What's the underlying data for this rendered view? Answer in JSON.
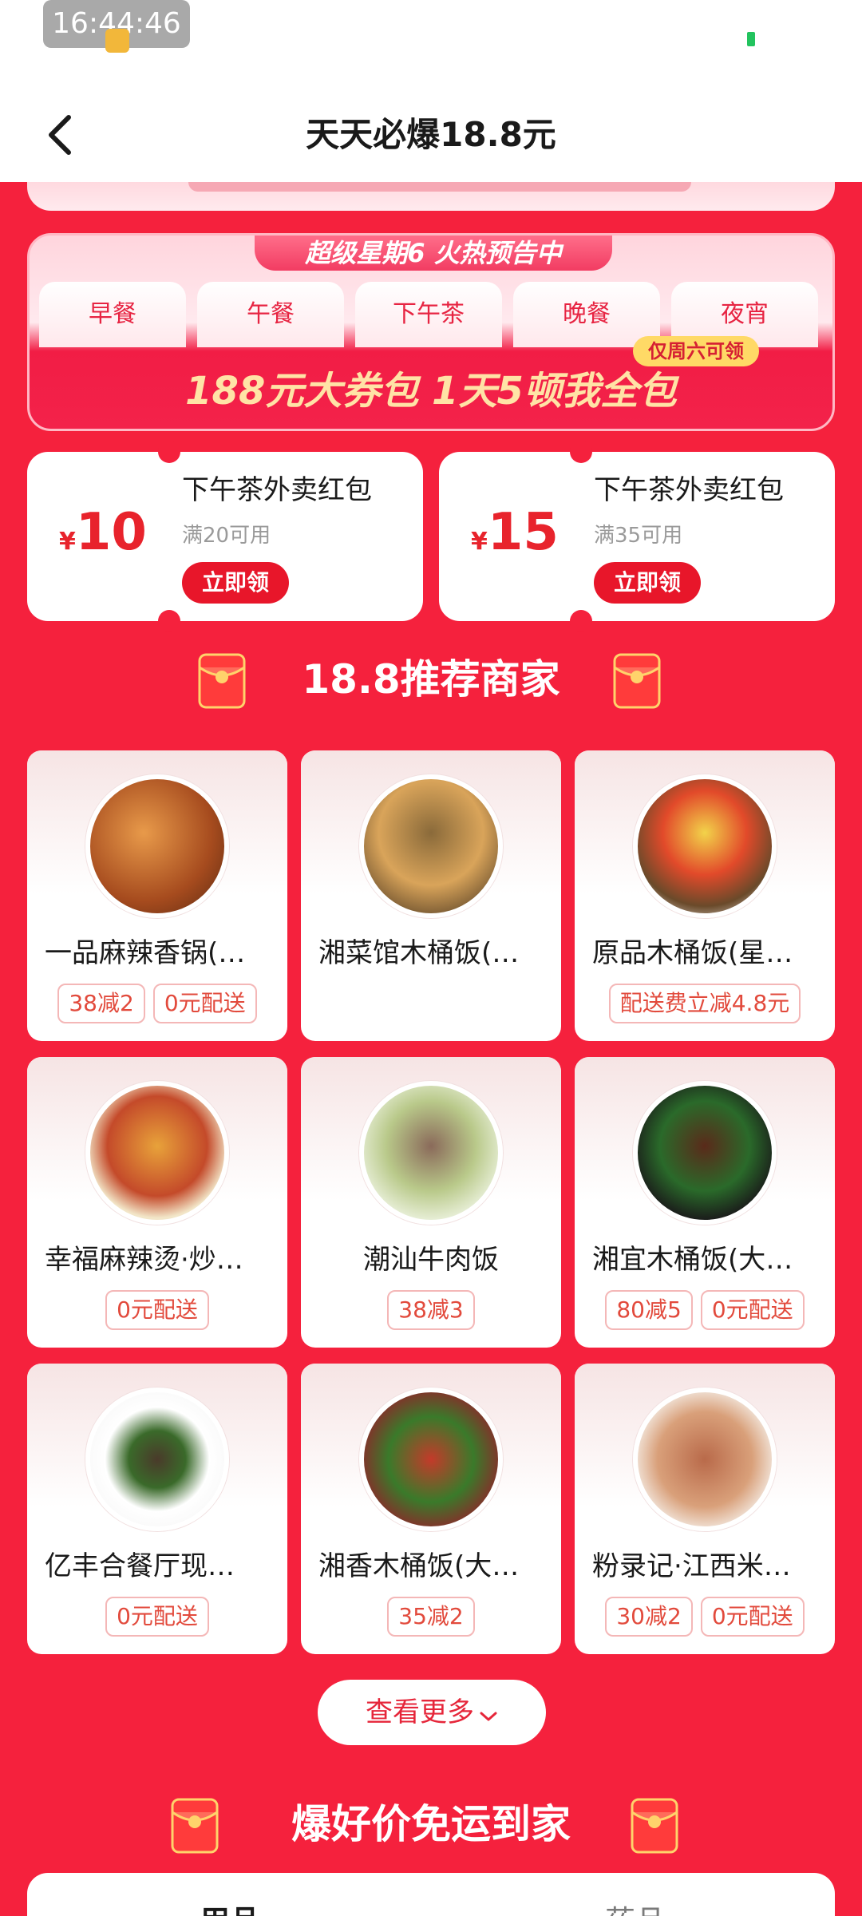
{
  "status_bar": {
    "time": "16:44:46"
  },
  "header": {
    "title": "天天必爆18.8元"
  },
  "promo_banner": {
    "tag": "超级星期6 火热预告中",
    "meals": [
      "早餐",
      "午餐",
      "下午茶",
      "晚餐",
      "夜宵"
    ],
    "weekday_badge": "仅周六可领",
    "slogan": "188元大券包 1天5顿我全包"
  },
  "coupons": [
    {
      "currency": "¥",
      "value": "10",
      "title": "下午茶外卖红包",
      "condition": "满20可用",
      "button": "立即领"
    },
    {
      "currency": "¥",
      "value": "15",
      "title": "下午茶外卖红包",
      "condition": "满35可用",
      "button": "立即领"
    }
  ],
  "merchants_section": {
    "title": "18.8推荐商家"
  },
  "merchants": [
    {
      "name": "一品麻辣香锅(…",
      "tags": [
        "38减2",
        "0元配送"
      ]
    },
    {
      "name": "湘菜馆木桶饭(…",
      "tags": []
    },
    {
      "name": "原品木桶饭(星…",
      "tags": [
        "配送费立减4.8元"
      ]
    },
    {
      "name": "幸福麻辣烫·炒…",
      "tags": [
        "0元配送"
      ]
    },
    {
      "name": "潮汕牛肉饭",
      "tags": [
        "38减3"
      ]
    },
    {
      "name": "湘宜木桶饭(大…",
      "tags": [
        "80减5",
        "0元配送"
      ]
    },
    {
      "name": "亿丰合餐厅现…",
      "tags": [
        "0元配送"
      ]
    },
    {
      "name": "湘香木桶饭(大…",
      "tags": [
        "35减2"
      ]
    },
    {
      "name": "粉录记·江西米…",
      "tags": [
        "30减2",
        "0元配送"
      ]
    }
  ],
  "more_button": {
    "label": "查看更多"
  },
  "free_delivery_section": {
    "title": "爆好价免运到家"
  },
  "bottom_tabs": [
    "用品",
    "药品"
  ],
  "colors": {
    "brand_red": "#f5213d",
    "button_red": "#e8162a",
    "tag_text": "#e24a3c"
  }
}
